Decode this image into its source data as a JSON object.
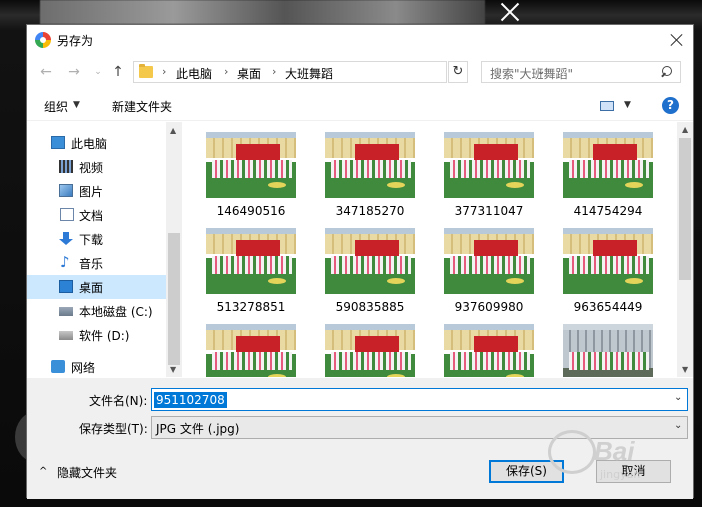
{
  "dialog": {
    "title": "另存为"
  },
  "nav": {
    "breadcrumbs": [
      "此电脑",
      "桌面",
      "大班舞蹈"
    ],
    "search_placeholder": "搜索\"大班舞蹈\""
  },
  "toolbar": {
    "organize": "组织",
    "new_folder": "新建文件夹"
  },
  "sidebar": {
    "items": [
      {
        "label": "此电脑",
        "icon": "computer-icon"
      },
      {
        "label": "视频",
        "icon": "video-icon"
      },
      {
        "label": "图片",
        "icon": "pictures-icon"
      },
      {
        "label": "文档",
        "icon": "documents-icon"
      },
      {
        "label": "下载",
        "icon": "download-icon"
      },
      {
        "label": "音乐",
        "icon": "music-icon"
      },
      {
        "label": "桌面",
        "icon": "desktop-icon",
        "selected": true
      },
      {
        "label": "本地磁盘 (C:)",
        "icon": "disk-icon"
      },
      {
        "label": "软件 (D:)",
        "icon": "drive-icon"
      },
      {
        "label": "网络",
        "icon": "network-icon"
      }
    ]
  },
  "files": [
    "146490516",
    "347185270",
    "377311047",
    "414754294",
    "513278851",
    "590835885",
    "937609980",
    "963654449",
    "",
    "",
    "",
    ""
  ],
  "form": {
    "filename_label": "文件名(N):",
    "filename_value": "951102708",
    "filetype_label": "保存类型(T):",
    "filetype_value": "JPG 文件 (.jpg)",
    "hide_folders": "隐藏文件夹",
    "save": "保存(S)",
    "cancel": "取消"
  },
  "watermark": {
    "brand": "Bai",
    "sub": "jingyan"
  },
  "colors": {
    "accent": "#0078d7",
    "selection": "#cce8ff"
  }
}
